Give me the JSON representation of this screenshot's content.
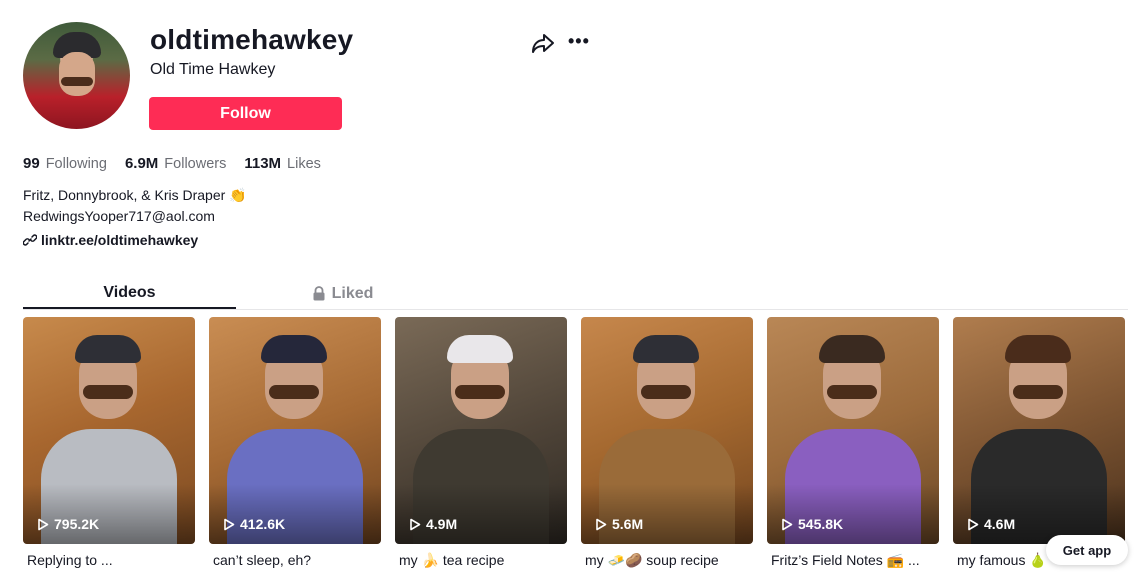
{
  "profile": {
    "username": "oldtimehawkey",
    "nickname": "Old Time Hawkey",
    "follow_label": "Follow"
  },
  "stats": [
    {
      "value": "99",
      "label": "Following"
    },
    {
      "value": "6.9M",
      "label": "Followers"
    },
    {
      "value": "113M",
      "label": "Likes"
    }
  ],
  "bio": {
    "line1": "Fritz, Donnybrook, & Kris Draper 👏",
    "line2": "RedwingsYooper717@aol.com"
  },
  "link": "linktr.ee/oldtimehawkey",
  "tabs": {
    "videos": "Videos",
    "liked": "Liked"
  },
  "videos": [
    {
      "views": "795.2K",
      "caption": "Replying to ..."
    },
    {
      "views": "412.6K",
      "caption": "can’t sleep, eh?"
    },
    {
      "views": "4.9M",
      "caption": "my 🍌 tea recipe"
    },
    {
      "views": "5.6M",
      "caption": "my 🧈🥔 soup recipe"
    },
    {
      "views": "545.8K",
      "caption": "Fritz’s Field Notes 📻 ..."
    },
    {
      "views": "4.6M",
      "caption": "my famous 🍐"
    }
  ],
  "get_app_label": "Get app",
  "colors": {
    "accent": "#fe2c55",
    "text": "#161823",
    "muted": "#6b6d74"
  },
  "icons": [
    "share-icon",
    "more-icon",
    "link-icon",
    "lock-icon",
    "play-icon"
  ]
}
